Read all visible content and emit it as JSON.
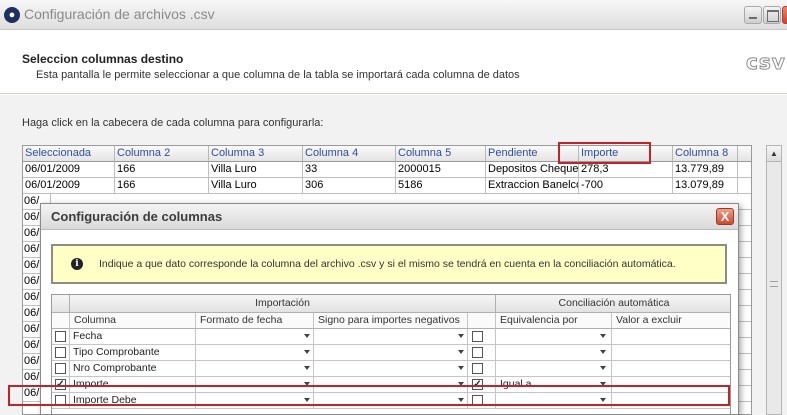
{
  "window": {
    "title": "Configuración de archivos .csv",
    "logo_text": "csv"
  },
  "header": {
    "title": "Seleccion columnas destino",
    "description": "Esta pantalla le permite seleccionar a que columna de la tabla se importará cada columna de datos"
  },
  "instruction": "Haga click en la cabecera de cada columna para configurarla:",
  "grid": {
    "columns": [
      "Seleccionada",
      "Columna 2",
      "Columna 3",
      "Columna 4",
      "Columna 5",
      "Pendiente",
      "Importe",
      "Columna 8"
    ],
    "rows": [
      [
        "06/01/2009",
        "166",
        "Villa Luro",
        "33",
        "2000015",
        "Depositos Cheque:",
        "278,3",
        "13.779,89"
      ],
      [
        "06/01/2009",
        "166",
        "Villa Luro",
        "306",
        "5186",
        "Extraccion Banelco",
        "-700",
        "13.079,89"
      ]
    ],
    "stub_rows": [
      "06/",
      "06/",
      "06/",
      "06/",
      "06/",
      "06/",
      "06/",
      "06/",
      "06/",
      "06/",
      "06/",
      "06/",
      "06/"
    ],
    "highlighted_column": "Importe"
  },
  "dialog": {
    "title": "Configuración de columnas",
    "close_label": "X",
    "info_icon": "i",
    "info_text": "Indique a que dato corresponde la columna del archivo .csv y si el mismo se tendrá en cuenta en la conciliación automática.",
    "group_import": "Importación",
    "group_conc": "Conciliación automática",
    "headers": {
      "columna": "Columna",
      "formato_fecha": "Formato de  fecha",
      "signo": "Signo para importes negativos",
      "equivalencia": "Equivalencia por",
      "valor_excluir": "Valor a excluir"
    },
    "rows": [
      {
        "label": "Fecha",
        "checked": false,
        "conc_checked": false,
        "equivalencia": ""
      },
      {
        "label": "Tipo Comprobante",
        "checked": false,
        "conc_checked": false,
        "equivalencia": ""
      },
      {
        "label": "Nro Comprobante",
        "checked": false,
        "conc_checked": false,
        "equivalencia": ""
      },
      {
        "label": "Importe",
        "checked": true,
        "conc_checked": true,
        "equivalencia": "Igual a"
      },
      {
        "label": "Importe Debe",
        "checked": false,
        "conc_checked": false,
        "equivalencia": ""
      }
    ]
  },
  "colors": {
    "header_text": "#2b4ea6",
    "highlight": "#c0242b",
    "info_background": "#ffffc6"
  }
}
